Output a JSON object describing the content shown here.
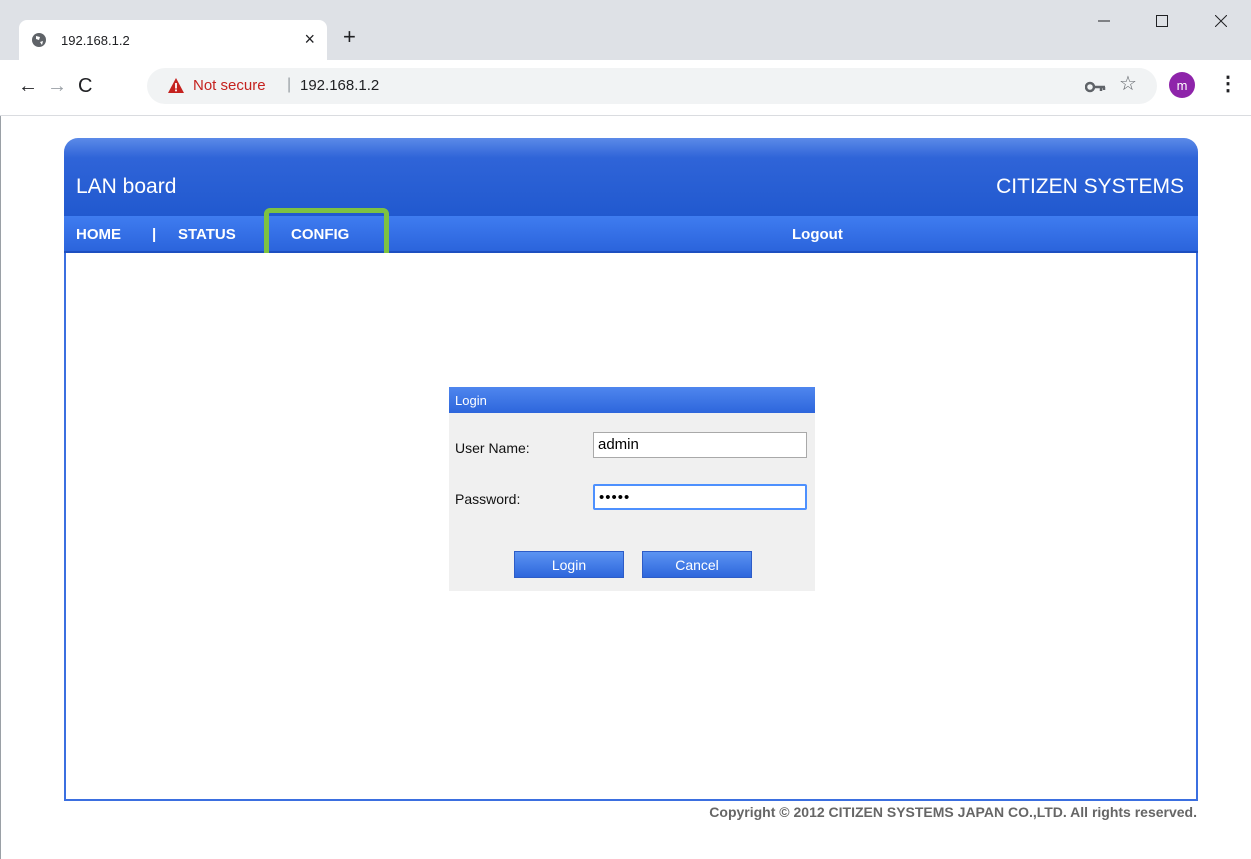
{
  "browser": {
    "tab_title": "192.168.1.2",
    "not_secure_label": "Not secure",
    "url": "192.168.1.2",
    "avatar_letter": "m"
  },
  "page": {
    "app_title": "LAN board",
    "brand": "CITIZEN SYSTEMS",
    "nav": {
      "home": "HOME",
      "separator": "|",
      "status": "STATUS",
      "config": "CONFIG",
      "logout": "Logout"
    },
    "login": {
      "heading": "Login",
      "username_label": "User Name:",
      "username_value": "admin",
      "password_label": "Password:",
      "password_value": "•••••",
      "login_button": "Login",
      "cancel_button": "Cancel"
    },
    "copyright": "Copyright © 2012 CITIZEN SYSTEMS JAPAN CO.,LTD. All rights reserved."
  },
  "colors": {
    "header_blue": "#2159cf",
    "highlight_green": "#7dc242",
    "not_secure_red": "#c5221f",
    "avatar_purple": "#8e24aa"
  }
}
